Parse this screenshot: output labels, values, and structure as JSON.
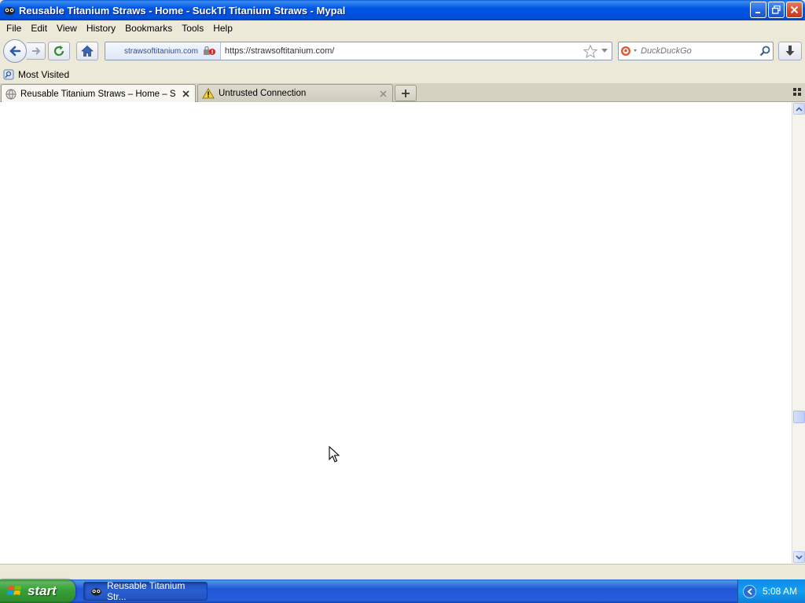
{
  "window": {
    "title": "Reusable Titanium Straws - Home - SuckTi Titanium Straws - Mypal"
  },
  "menu": [
    "File",
    "Edit",
    "View",
    "History",
    "Bookmarks",
    "Tools",
    "Help"
  ],
  "navbar": {
    "identity_label": "strawsoftitanium.com",
    "url": "https://strawsoftitanium.com/",
    "search_placeholder": "DuckDuckGo"
  },
  "bookmarks": {
    "most_visited": "Most Visited"
  },
  "tabs": [
    {
      "label": "Reusable Titanium Straws – Home – Suck...",
      "active": true
    },
    {
      "label": "Untrusted Connection",
      "active": false
    }
  ],
  "taskbar": {
    "start_label": "start",
    "window_button": "Reusable Titanium Str...",
    "clock": "5:08 AM"
  },
  "colors": {
    "titlebar": "#0055e5",
    "taskbar": "#245edb",
    "start_button": "#37a137",
    "tray": "#139ff0"
  }
}
